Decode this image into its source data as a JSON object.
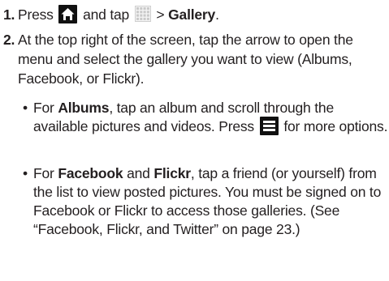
{
  "steps": [
    {
      "number": "1.",
      "press": "Press",
      "and_tap": "and tap",
      "arrow": ">",
      "gallery": "Gallery",
      "period": ".",
      "icons": [
        "home-key-icon",
        "applications-grid-icon"
      ]
    },
    {
      "number": "2.",
      "text": "At the top right of the screen, tap the arrow to open the menu and select the gallery you want to view (Albums, Facebook, or Flickr)."
    }
  ],
  "bullets": [
    {
      "dot": "•",
      "for": "For",
      "albums": "Albums",
      "text_a": ", tap an album and scroll through the available pictures and videos. Press",
      "text_b": "for more options.",
      "icon": "menu-key-icon"
    },
    {
      "dot": "•",
      "for": "For",
      "facebook": "Facebook",
      "and": "and",
      "flickr": "Flickr",
      "text": ", tap a friend (or yourself) from the list to view posted pictures. You must be signed on to Facebook or Flickr to access those galleries. (See “Facebook, Flickr, and Twitter” on page 23.)"
    }
  ]
}
